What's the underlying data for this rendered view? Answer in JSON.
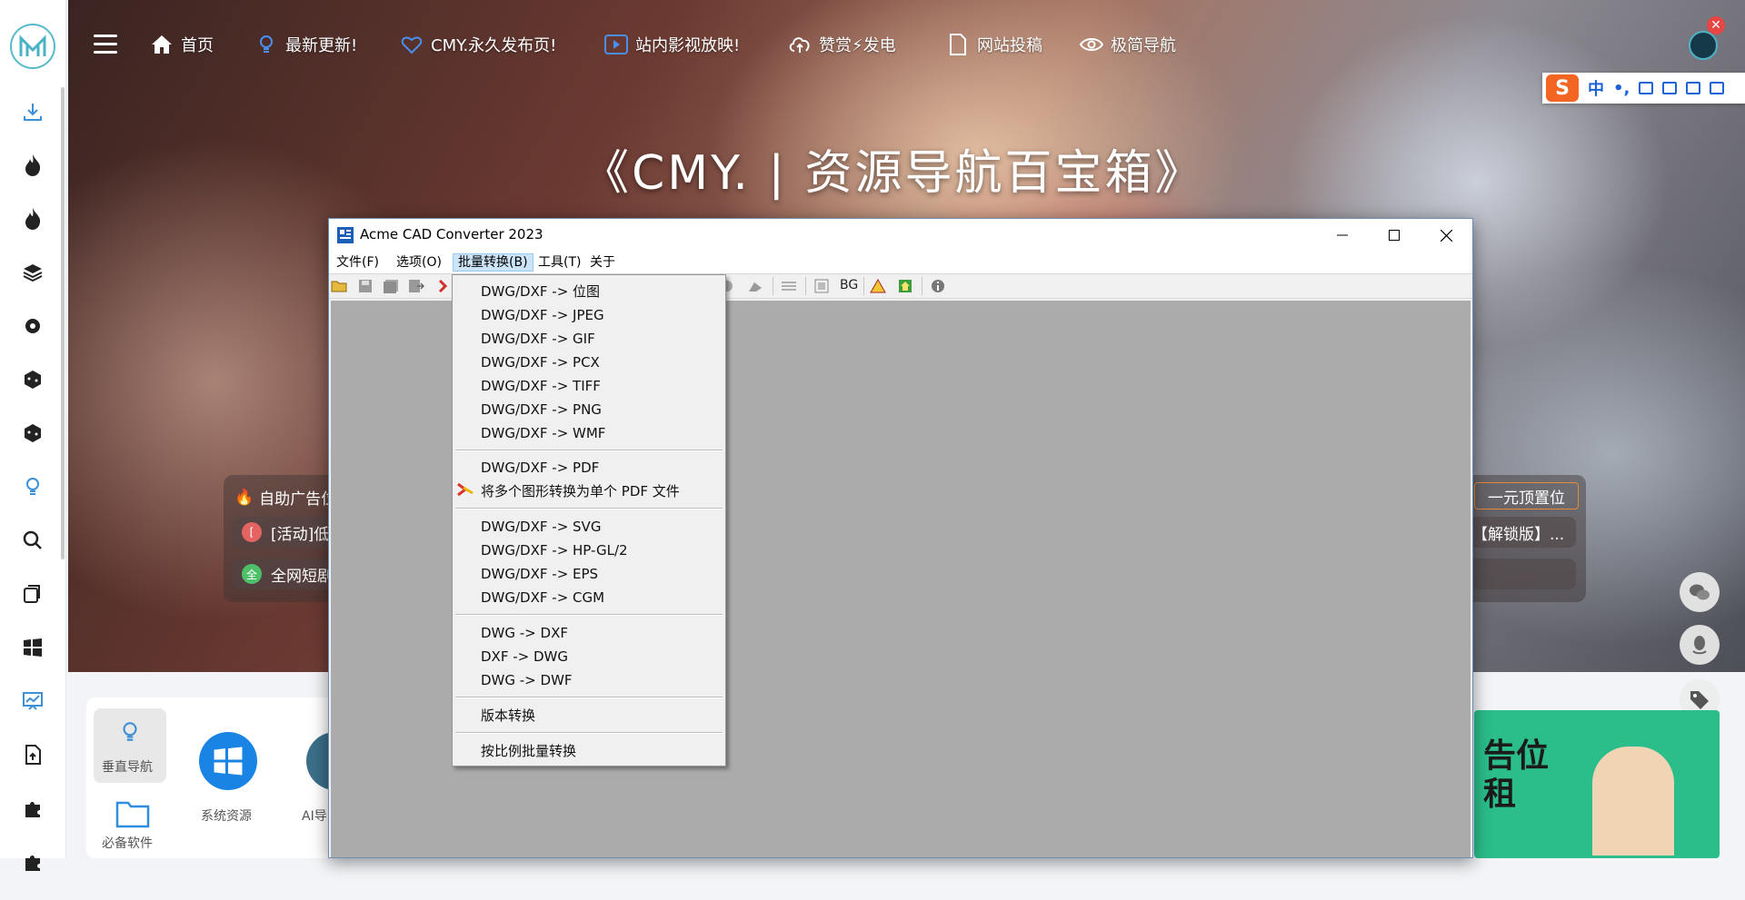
{
  "site": {
    "title": "《CMY. | 资源导航百宝箱》",
    "nav": [
      {
        "label": "首页",
        "icon": "home-icon"
      },
      {
        "label": "最新更新!",
        "icon": "bulb-icon"
      },
      {
        "label": "CMY.永久发布页!",
        "icon": "heart-icon"
      },
      {
        "label": "站内影视放映!",
        "icon": "play-icon"
      },
      {
        "label": "赞赏⚡发电",
        "icon": "cloud-upload-icon"
      },
      {
        "label": "网站投稿",
        "icon": "document-icon"
      },
      {
        "label": "极简导航",
        "icon": "eye-icon"
      }
    ],
    "ime": {
      "logo": "S",
      "mode": "中",
      "punct": "•,"
    },
    "ads": {
      "left_header": "自助广告位",
      "left_lines": [
        "[活动]低",
        "全网短剧"
      ],
      "left_dots": [
        "[",
        "全"
      ],
      "right_header": "一元顶置位",
      "right_lines": [
        "【解锁版】..."
      ]
    },
    "bottom": {
      "tiles": [
        {
          "label": "垂直导航",
          "icon": "bulb-icon"
        },
        {
          "label": "必备软件",
          "icon": "folder-icon"
        },
        {
          "label": "系统资源",
          "icon": "windows-icon"
        },
        {
          "label": "AI导",
          "icon": "ai-avatar-icon"
        }
      ],
      "banner_text": "告位\n租"
    },
    "sidebar_icons": [
      "download-icon",
      "fire-icon",
      "fire-icon",
      "layers-icon",
      "gear-group-icon",
      "cube-icon",
      "cube-icon",
      "bulb-icon",
      "search-icon",
      "copy-icon",
      "windows-icon",
      "chart-board-icon",
      "document-upload-icon",
      "puzzle-icon",
      "puzzle-icon"
    ]
  },
  "app": {
    "title": "Acme CAD Converter 2023",
    "menu": [
      "文件(F)",
      "选项(O)",
      "批量转换(B)",
      "工具(T)",
      "关于"
    ],
    "toolbar_text": "BG",
    "batch_menu": {
      "group1": [
        "DWG/DXF -> 位图",
        "DWG/DXF -> JPEG",
        "DWG/DXF -> GIF",
        "DWG/DXF -> PCX",
        "DWG/DXF -> TIFF",
        "DWG/DXF -> PNG",
        "DWG/DXF -> WMF"
      ],
      "group2": [
        "DWG/DXF -> PDF",
        "将多个图形转换为单个 PDF 文件"
      ],
      "group3": [
        "DWG/DXF -> SVG",
        "DWG/DXF -> HP-GL/2",
        "DWG/DXF -> EPS",
        "DWG/DXF -> CGM"
      ],
      "group4": [
        "DWG -> DXF",
        "DXF -> DWG",
        "DWG -> DWF"
      ],
      "group5": [
        "版本转换"
      ],
      "group6": [
        "按比例批量转换"
      ]
    }
  }
}
